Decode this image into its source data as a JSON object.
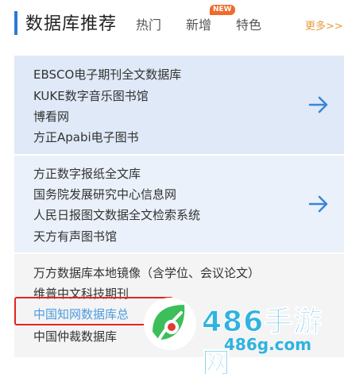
{
  "header": {
    "title": "数据库推荐",
    "tabs": [
      {
        "label": "热门"
      },
      {
        "label": "新增",
        "badge": "NEW"
      },
      {
        "label": "特色"
      }
    ],
    "more": "更多>>"
  },
  "panels": [
    {
      "items": [
        "EBSCO电子期刊全文数据库",
        "KUKE数字音乐图书馆",
        "博看网",
        "方正Apabi电子图书"
      ]
    },
    {
      "items": [
        "方正数字报纸全文库",
        "国务院发展研究中心信息网",
        "人民日报图文数据全文检索系统",
        "天方有声图书馆"
      ]
    },
    {
      "items": [
        "万方数据库本地镜像（含学位、会议论文）",
        "维普中文科技期刊",
        "中国知网数据库总",
        "中国仲裁数据库"
      ]
    }
  ],
  "icons": {
    "panel_arrow": "arrow-right-icon",
    "watermark_logo": "leaf-logo-icon"
  },
  "colors": {
    "accent": "#2f7ad1",
    "arrow": "#3a85d6",
    "highlight_border": "#e0271f",
    "more_link": "#e89a3c",
    "watermark": "#2fb3e0"
  },
  "watermark": {
    "brand": "486手游网",
    "domain": "486g.com"
  }
}
